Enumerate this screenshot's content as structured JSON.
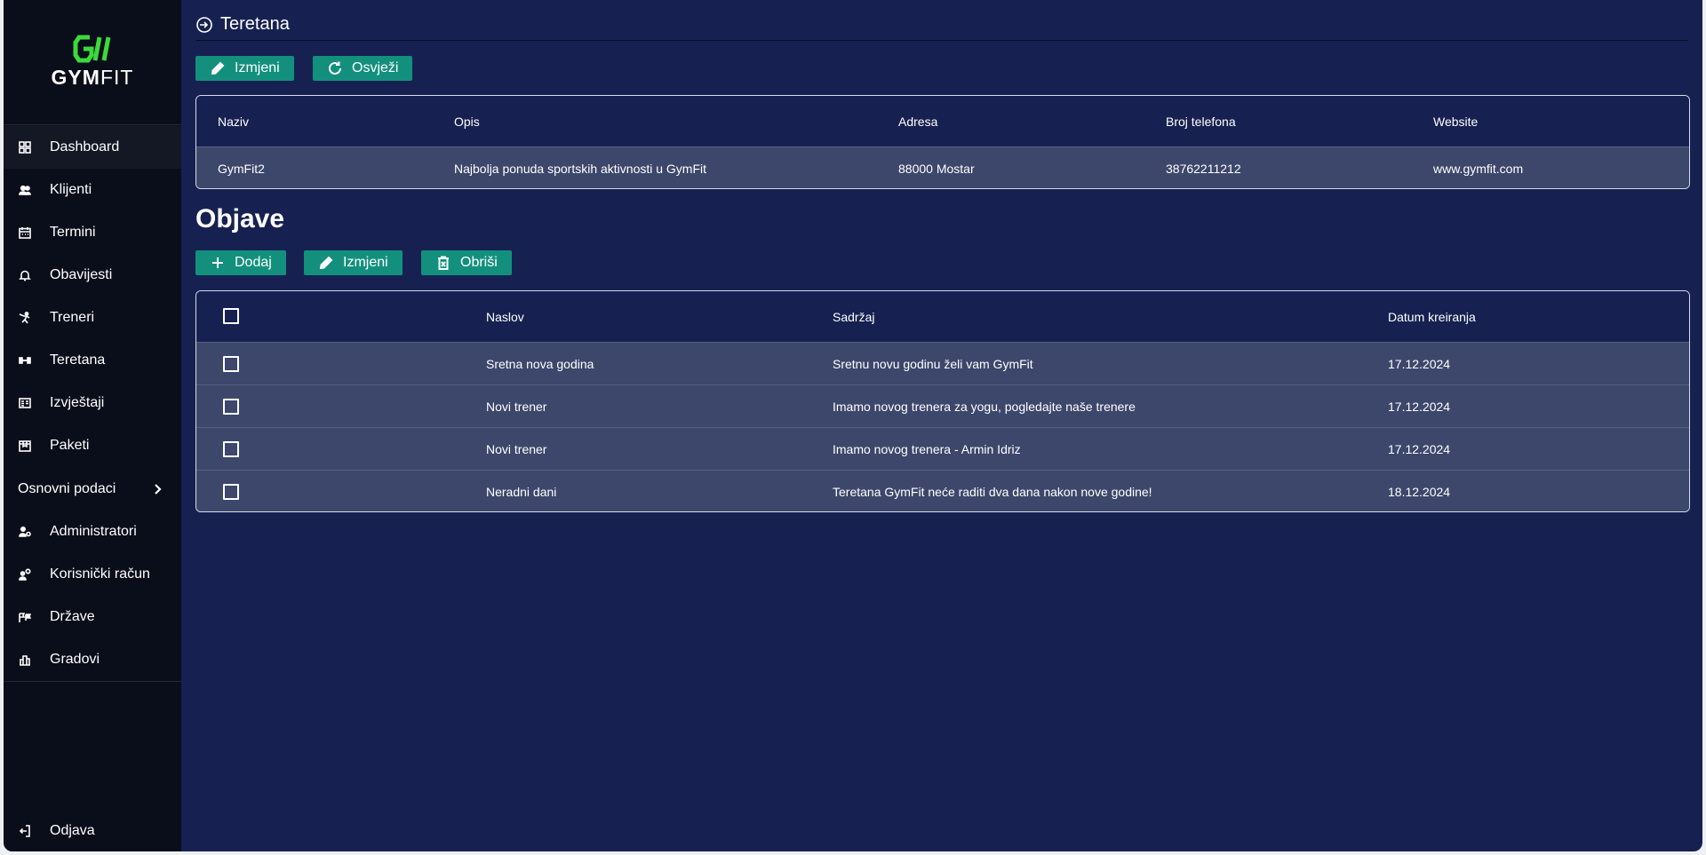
{
  "sidebar": {
    "logo_text_bold": "GYM",
    "logo_text_light": "FIT",
    "items": [
      {
        "label": "Dashboard",
        "icon": "dashboard-icon"
      },
      {
        "label": "Klijenti",
        "icon": "users-icon"
      },
      {
        "label": "Termini",
        "icon": "calendar-icon"
      },
      {
        "label": "Obavijesti",
        "icon": "bell-icon"
      },
      {
        "label": "Treneri",
        "icon": "trainer-icon"
      },
      {
        "label": "Teretana",
        "icon": "dumbbell-icon"
      },
      {
        "label": "Izvještaji",
        "icon": "report-icon"
      },
      {
        "label": "Paketi",
        "icon": "package-icon"
      }
    ],
    "group": {
      "label": "Osnovni podaci"
    },
    "group_items": [
      {
        "label": "Administratori",
        "icon": "admin-icon"
      },
      {
        "label": "Korisnički račun",
        "icon": "account-settings-icon"
      },
      {
        "label": "Države",
        "icon": "flags-icon"
      },
      {
        "label": "Gradovi",
        "icon": "city-icon"
      }
    ],
    "logout_label": "Odjava"
  },
  "header": {
    "title": "Teretana"
  },
  "gym_toolbar": {
    "edit_label": "Izmjeni",
    "refresh_label": "Osvježi"
  },
  "gym_table": {
    "columns": [
      "Naziv",
      "Opis",
      "Adresa",
      "Broj telefona",
      "Website"
    ],
    "row": [
      "GymFit2",
      "Najbolja ponuda sportskih aktivnosti u GymFit",
      "88000 Mostar",
      "38762211212",
      "www.gymfit.com"
    ]
  },
  "posts": {
    "title": "Objave",
    "toolbar": {
      "add_label": "Dodaj",
      "edit_label": "Izmjeni",
      "delete_label": "Obriši"
    },
    "columns": [
      "Naslov",
      "Sadržaj",
      "Datum kreiranja"
    ],
    "rows": [
      [
        "Sretna nova godina",
        "Sretnu novu godinu želi vam GymFit",
        "17.12.2024"
      ],
      [
        "Novi trener",
        "Imamo novog trenera za yogu, pogledajte naše trenere",
        "17.12.2024"
      ],
      [
        "Novi trener",
        "Imamo novog trenera - Armin Idriz",
        "17.12.2024"
      ],
      [
        "Neradni dani",
        "Teretana GymFit neće raditi dva dana nakon nove godine!",
        "18.12.2024"
      ]
    ]
  },
  "colors": {
    "background": "#172151",
    "sidebar": "#0a0e1a",
    "accent_button": "#13907d",
    "logo_green": "#3cd93c",
    "row_fill": "#3d476b"
  }
}
